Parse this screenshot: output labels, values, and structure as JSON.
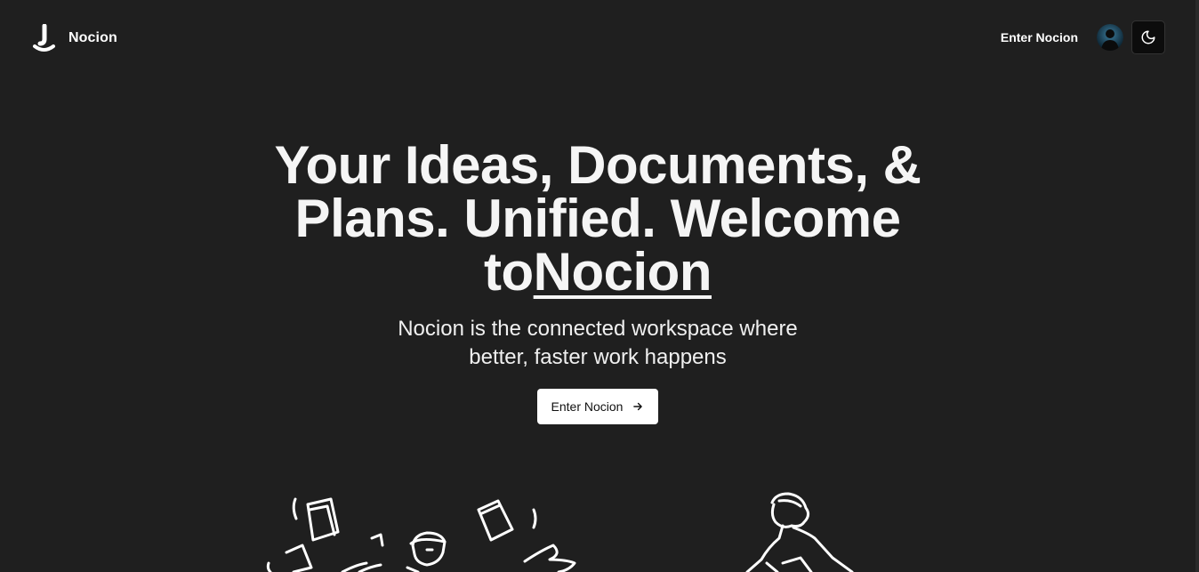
{
  "app": {
    "name": "Nocion",
    "logo_icon": "jotion-logo-icon"
  },
  "nav": {
    "enter_label": "Enter Nocion",
    "avatar_icon": "user-avatar",
    "theme_icon": "moon-icon"
  },
  "hero": {
    "title_line": "Your Ideas, Documents, & Plans. Unified. Welcome to",
    "title_brand": "Nocion",
    "subtitle": "Nocion is the connected workspace where better, faster work happens",
    "cta_label": "Enter Nocion",
    "cta_icon": "arrow-right-icon"
  },
  "illustrations": {
    "left": "person-juggling-documents-illustration",
    "right": "person-reading-illustration"
  },
  "colors": {
    "background": "#1f1f1f",
    "text": "#ffffff",
    "button_bg": "#ffffff",
    "button_text": "#111111",
    "toggle_bg": "#0c0c0c"
  }
}
